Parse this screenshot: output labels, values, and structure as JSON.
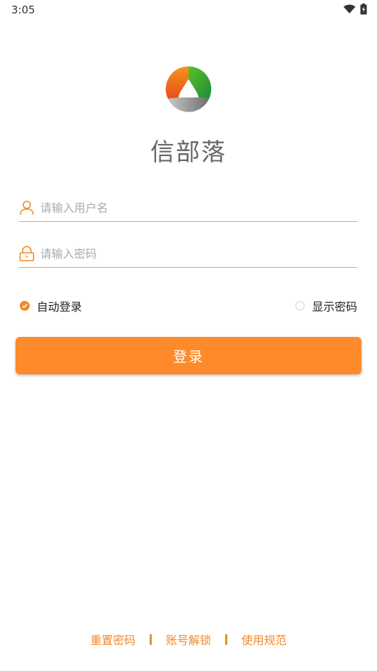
{
  "status_bar": {
    "time": "3:05"
  },
  "app": {
    "brand_name": "信部落"
  },
  "form": {
    "username_placeholder": "请输入用户名",
    "password_placeholder": "请输入密码",
    "auto_login_label": "自动登录",
    "auto_login_checked": true,
    "show_password_label": "显示密码",
    "show_password_checked": false,
    "login_button_label": "登录"
  },
  "footer": {
    "links": [
      "重置密码",
      "账号解锁",
      "使用规范"
    ]
  },
  "colors": {
    "accent": "#ff8a2b",
    "link": "#f08a2a"
  },
  "icons": [
    "wifi-icon",
    "battery-icon",
    "logo-icon",
    "user-icon",
    "lock-icon",
    "check-circle-icon",
    "radio-empty-icon"
  ]
}
